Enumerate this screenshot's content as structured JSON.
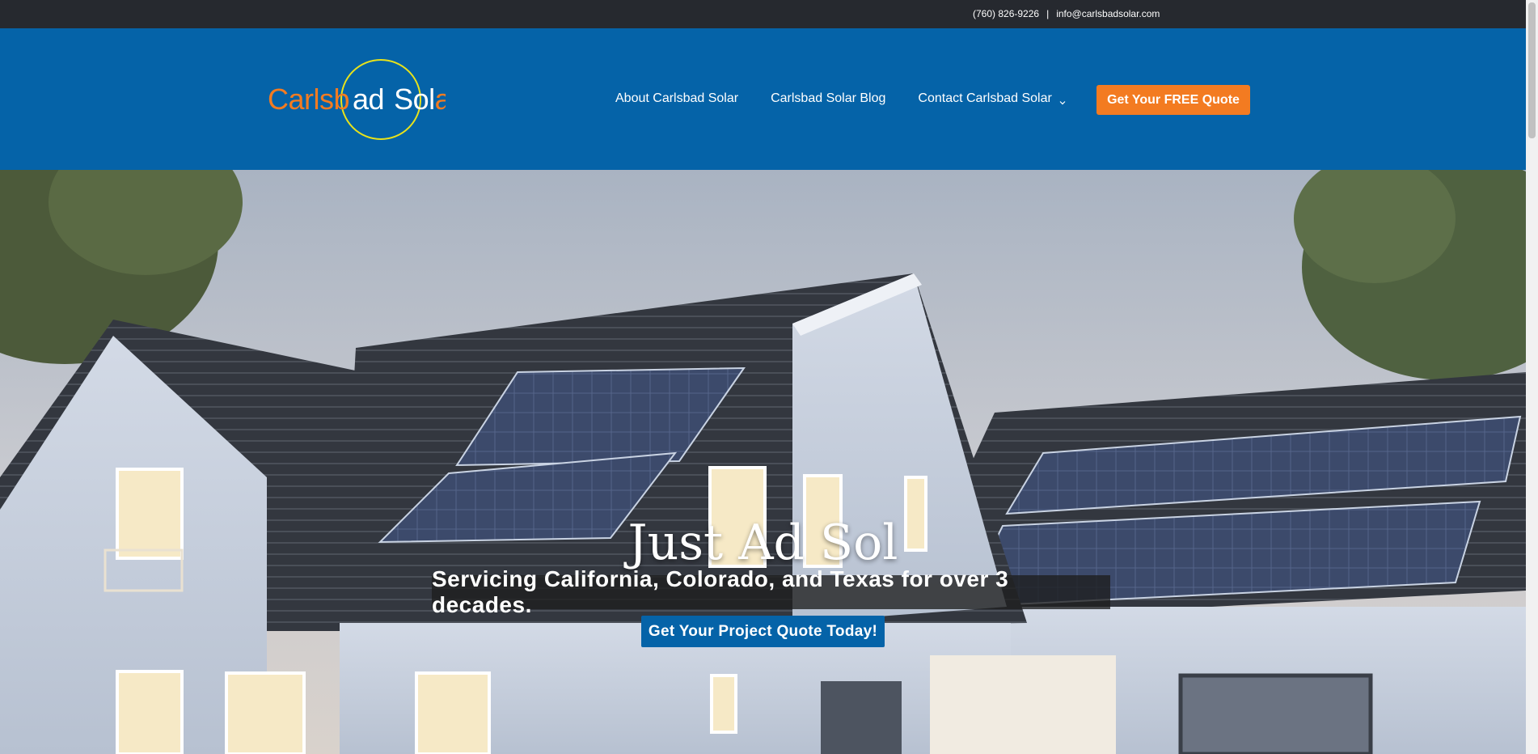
{
  "topbar": {
    "phone": "(760) 826-9226",
    "separator": "|",
    "email": "info@carlsbadsolar.com"
  },
  "logo": {
    "text_part1": "Carlsb",
    "text_part2": "ad",
    "text_part3": "So",
    "text_part4": "l",
    "text_part5": "ar"
  },
  "nav": {
    "items": [
      {
        "label": "About Carlsbad Solar"
      },
      {
        "label": "Carlsbad Solar Blog"
      },
      {
        "label": "Contact Carlsbad Solar"
      }
    ],
    "cta_label": "Get Your FREE Quote"
  },
  "hero": {
    "title": "Just Ad Sol",
    "subtitle": "Servicing California, Colorado, and Texas for over 3 decades.",
    "cta_label": "Get Your Project Quote Today!"
  },
  "colors": {
    "topbar": "#26292f",
    "header": "#0563a8",
    "accent_orange": "#f37b21",
    "logo_circle": "#e8e21b"
  },
  "icons": [
    "chevron-down-icon"
  ]
}
